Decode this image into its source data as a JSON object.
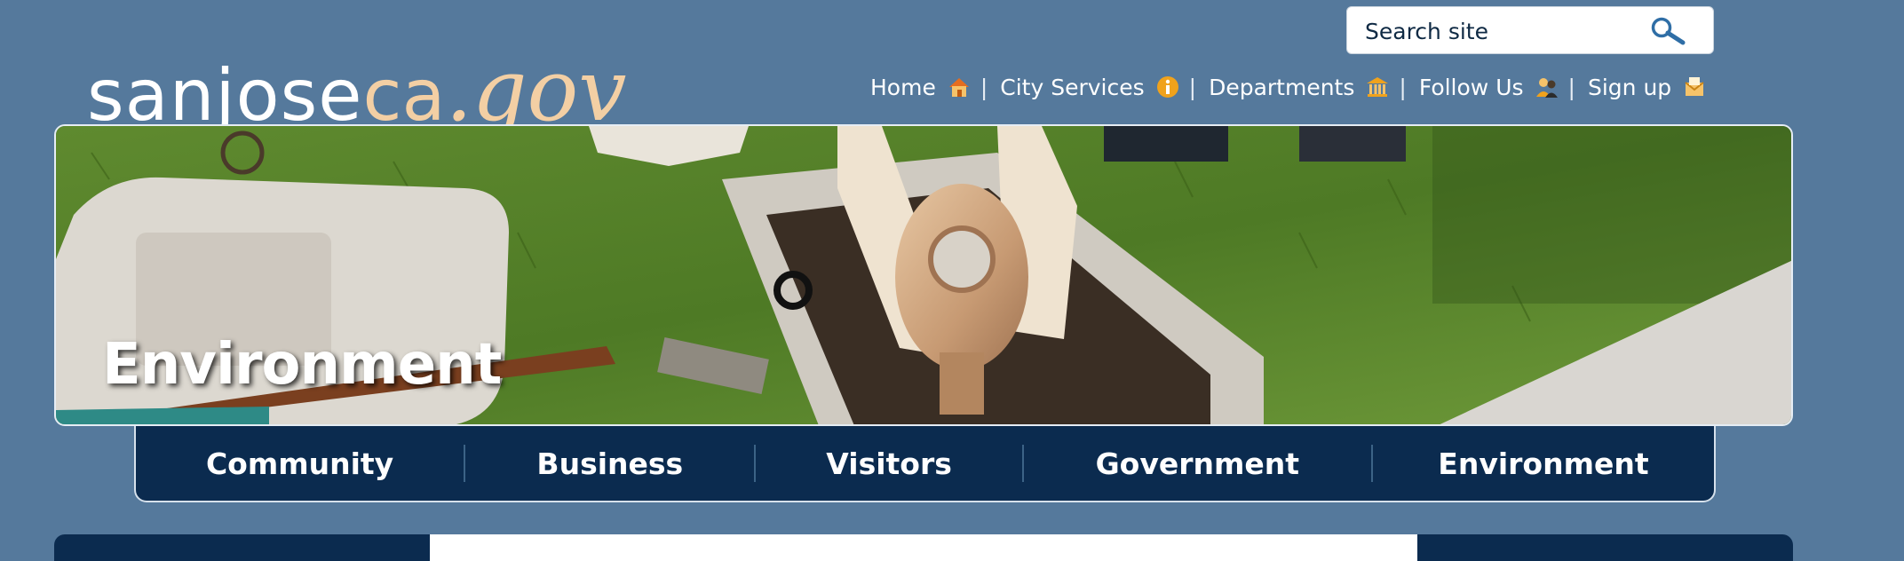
{
  "logo": {
    "part1": "sanjose",
    "part2": "ca",
    "part3": ".gov"
  },
  "search": {
    "placeholder": "Search site",
    "icon": "magnifier-icon"
  },
  "topnav": {
    "items": [
      {
        "label": "Home",
        "icon": "house-icon"
      },
      {
        "label": "City Services",
        "icon": "info-icon"
      },
      {
        "label": "Departments",
        "icon": "building-icon"
      },
      {
        "label": "Follow Us",
        "icon": "people-icon"
      },
      {
        "label": "Sign up",
        "icon": "envelope-icon"
      }
    ],
    "separator": "|"
  },
  "hero": {
    "title": "Environment"
  },
  "mainnav": {
    "tabs": [
      {
        "label": "Community"
      },
      {
        "label": "Business"
      },
      {
        "label": "Visitors"
      },
      {
        "label": "Government"
      },
      {
        "label": "Environment"
      }
    ]
  },
  "colors": {
    "page_bg": "#55799c",
    "nav_bg": "#0b2b4f",
    "logo_accent": "#f3cfa4",
    "icon_orange": "#f0a21c"
  }
}
